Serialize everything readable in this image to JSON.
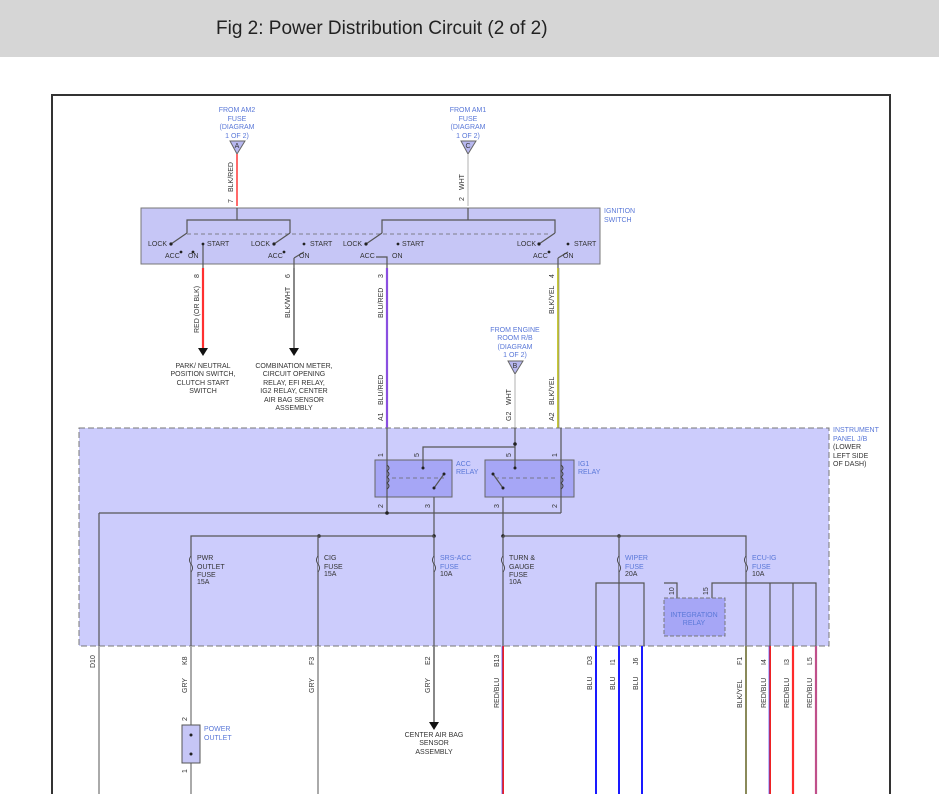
{
  "title": "Fig 2: Power Distribution Circuit (2 of 2)",
  "sources": {
    "am2": {
      "lines": [
        "FROM AM2",
        "FUSE",
        "(DIAGRAM",
        "1 OF 2)"
      ],
      "connector": "A"
    },
    "am1": {
      "lines": [
        "FROM AM1",
        "FUSE",
        "(DIAGRAM",
        "1 OF 2)"
      ],
      "connector": "C"
    },
    "engine_room": {
      "lines": [
        "FROM ENGINE",
        "ROOM R/B",
        "(DIAGRAM",
        "1 OF 2)"
      ],
      "connector": "B"
    }
  },
  "ignition_switch": {
    "label": [
      "IGNITION",
      "SWITCH"
    ],
    "positions": {
      "lock": "LOCK",
      "acc": "ACC",
      "on": "ON",
      "start": "START"
    },
    "input_wires": [
      {
        "pin": "7",
        "color": "BLK/RED"
      },
      {
        "pin": "2",
        "color": "WHT"
      }
    ],
    "output_wires": [
      {
        "pin": "8",
        "color": "RED (OR BLK)"
      },
      {
        "pin": "6",
        "color": "BLK/WHT"
      },
      {
        "pin": "3",
        "color": "BLU/RED"
      },
      {
        "pin": "4",
        "color": "BLK/YEL"
      }
    ]
  },
  "destinations": {
    "park_neutral": [
      "PARK/ NEUTRAL",
      "POSITION SWITCH,",
      "CLUTCH START",
      "SWITCH"
    ],
    "combo_meter": [
      "COMBINATION METER,",
      "CIRCUIT OPENING",
      "RELAY, EFI RELAY,",
      "IG2 RELAY, CENTER",
      "AIR BAG SENSOR",
      "ASSEMBLY"
    ],
    "center_airbag": [
      "CENTER AIR BAG",
      "SENSOR",
      "ASSEMBLY"
    ]
  },
  "jb_inputs": [
    {
      "pin": "A1",
      "color": "BLU/RED"
    },
    {
      "pin": "G2",
      "color": "WHT"
    },
    {
      "pin": "A2",
      "color": "BLK/YEL"
    }
  ],
  "junction_block": {
    "label": [
      "INSTRUMENT",
      "PANEL J/B",
      "(LOWER",
      "LEFT SIDE",
      "OF DASH)"
    ]
  },
  "relays": {
    "acc": {
      "label": [
        "ACC",
        "RELAY"
      ],
      "pins": [
        "1",
        "5",
        "2",
        "3"
      ]
    },
    "ig1": {
      "label": [
        "IG1",
        "RELAY"
      ],
      "pins": [
        "5",
        "1",
        "3",
        "2"
      ]
    },
    "integration": {
      "label": [
        "INTEGRATION",
        "RELAY"
      ],
      "pins": [
        "10",
        "15"
      ]
    }
  },
  "fuses": [
    {
      "lines": [
        "PWR",
        "OUTLET",
        "FUSE",
        "15A"
      ]
    },
    {
      "lines": [
        "CIG",
        "FUSE",
        "15A"
      ]
    },
    {
      "lines": [
        "SRS-ACC",
        "FUSE",
        "10A"
      ]
    },
    {
      "lines": [
        "TURN &",
        "GAUGE",
        "FUSE",
        "10A"
      ]
    },
    {
      "lines": [
        "WIPER",
        "FUSE",
        "20A"
      ]
    },
    {
      "lines": [
        "ECU-IG",
        "FUSE",
        "10A"
      ]
    }
  ],
  "outputs": [
    {
      "pin": "D10",
      "color": ""
    },
    {
      "pin": "K8",
      "color": "GRY"
    },
    {
      "pin": "F3",
      "color": "GRY"
    },
    {
      "pin": "E2",
      "color": "GRY"
    },
    {
      "pin": "B13",
      "color": "RED/BLU"
    },
    {
      "pin": "D3",
      "color": "BLU"
    },
    {
      "pin": "I1",
      "color": "BLU"
    },
    {
      "pin": "J6",
      "color": "BLU"
    },
    {
      "pin": "F1",
      "color": "BLK/YEL"
    },
    {
      "pin": "I4",
      "color": "RED/BLU"
    },
    {
      "pin": "I3",
      "color": "RED/BLU"
    },
    {
      "pin": "L5",
      "color": "RED/BLU"
    }
  ],
  "power_outlet": {
    "label": [
      "POWER",
      "OUTLET"
    ],
    "pins": [
      "2",
      "1"
    ]
  }
}
